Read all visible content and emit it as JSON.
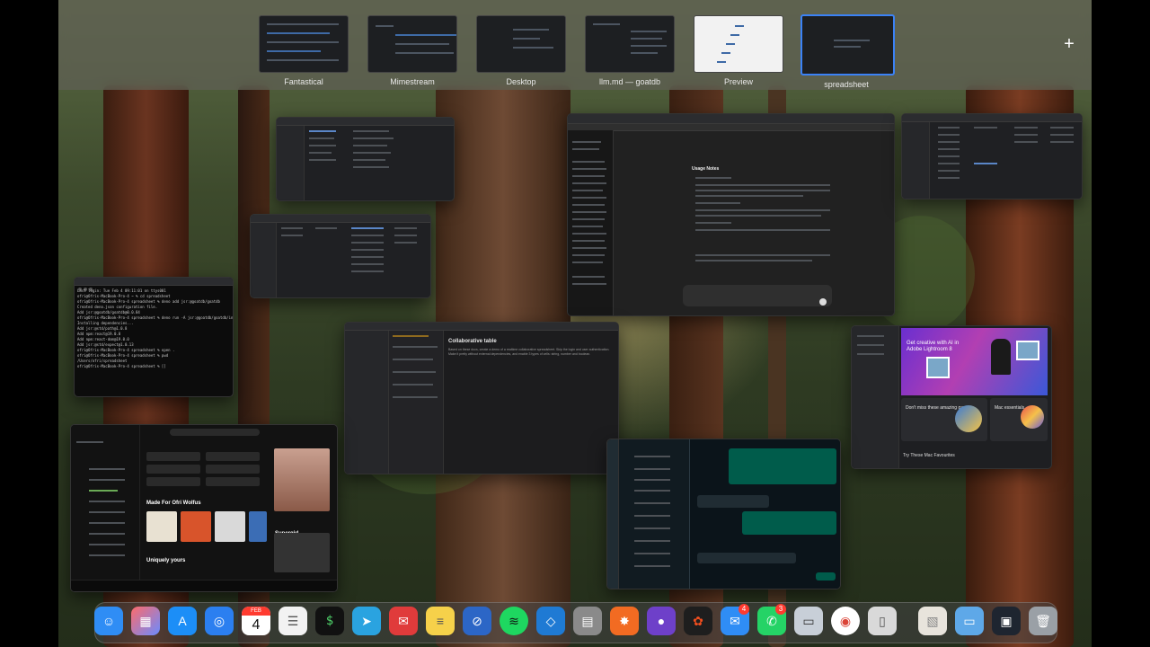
{
  "spaces": [
    {
      "label": "Fantastical",
      "active": false
    },
    {
      "label": "Mimestream",
      "active": false
    },
    {
      "label": "Desktop",
      "active": false
    },
    {
      "label": "llm.md — goatdb",
      "active": false
    },
    {
      "label": "Preview",
      "active": false
    },
    {
      "label": "spreadsheet",
      "active": true
    }
  ],
  "add_space_symbol": "+",
  "chatgpt": {
    "heading": "Usage Notes"
  },
  "collab_doc": {
    "title": "Collaborative table",
    "body": "Based on these docs, create a demo of a realtime collaborative spreadsheet. Skip the login and user authentication. Make it pretty without external dependencies, and enable 3 types of cells: string, number and boolean."
  },
  "lightroom": {
    "banner": "Get creative with AI in Adobe Lightroom 8",
    "card1": "Don't miss these amazing games",
    "card2": "Mac essentials",
    "footer": "Try These Mac Favourites"
  },
  "spotify": {
    "section_title": "Made For Ofri Wolfus",
    "section2_title": "Uniquely yours",
    "artist": "Supergirl"
  },
  "dock": {
    "calendar_month": "FEB",
    "calendar_day": "4",
    "mail_badge": "4",
    "whatsapp_badge": "3"
  }
}
